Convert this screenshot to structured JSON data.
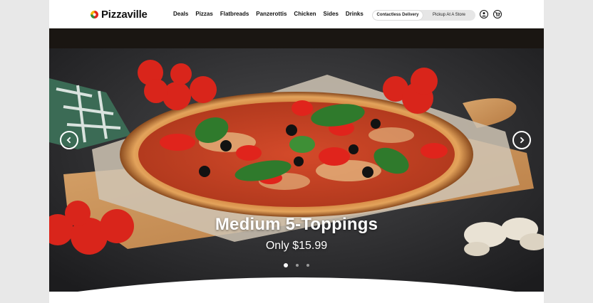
{
  "brand": {
    "name": "Pizzaville",
    "colors": {
      "red": "#e2231a",
      "green": "#2e8b3d",
      "yellow": "#f6b400"
    }
  },
  "nav": {
    "items": [
      {
        "label": "Deals"
      },
      {
        "label": "Pizzas"
      },
      {
        "label": "Flatbreads"
      },
      {
        "label": "Panzerottis"
      },
      {
        "label": "Chicken"
      },
      {
        "label": "Sides"
      },
      {
        "label": "Drinks"
      }
    ]
  },
  "order_mode": {
    "options": [
      {
        "label": "Contactless Delivery",
        "selected": true
      },
      {
        "label": "Pickup At A Store",
        "selected": false
      }
    ]
  },
  "header_icons": {
    "account": "user-icon",
    "cart": "cart-icon"
  },
  "hero": {
    "title": "Medium 5-Toppings",
    "subtitle": "Only $15.99",
    "slide_count": 3,
    "active_slide": 1,
    "prev_icon": "chevron-left-icon",
    "next_icon": "chevron-right-icon"
  }
}
